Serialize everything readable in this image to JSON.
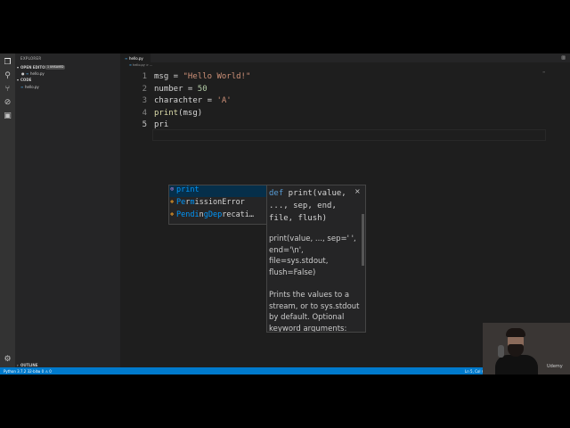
{
  "explorer": {
    "title": "EXPLORER",
    "open_editors": {
      "label": "OPEN EDITORS",
      "badge": "1 UNSAVED",
      "files": [
        {
          "name": "hello.py"
        }
      ]
    },
    "folder": {
      "label": "CODE",
      "files": [
        {
          "name": "hello.py"
        }
      ]
    },
    "outline_label": "OUTLINE"
  },
  "tab": {
    "name": "hello.py"
  },
  "breadcrumb": {
    "file": "hello.py",
    "rest": " > ..."
  },
  "editor": {
    "lines": [
      {
        "n": "1",
        "before": "msg = ",
        "str": "\"Hello World!\"",
        "after": ""
      },
      {
        "n": "2",
        "before": "number = ",
        "num": "50"
      },
      {
        "n": "3",
        "before": "charachter = ",
        "str": "'A'",
        "after": ""
      },
      {
        "n": "4",
        "fn": "print",
        "after": "(msg)"
      },
      {
        "n": "5",
        "before": "pri"
      }
    ]
  },
  "suggest": {
    "items": [
      {
        "icon": "method-icon",
        "match": "print",
        "rest": "",
        "selected": true
      },
      {
        "icon": "class-icon",
        "p1": "Pe",
        "m1": "r",
        "p2": "m",
        "m2": "i",
        "p3": "ssionError"
      },
      {
        "icon": "class-icon",
        "p1": "Pendi",
        "m1": "n",
        "p2": "gDep",
        "m2": "r",
        "p3": "ecati…"
      }
    ]
  },
  "detail": {
    "sig_kw": "def",
    "sig_rest": " print(value, ..., sep, end, file, flush)",
    "close": "×",
    "doc1": "print(value, ..., sep=' ', end='\\n', file=sys.stdout, flush=False)",
    "doc2": "Prints the values to a stream, or to sys.stdout by default. Optional keyword arguments:"
  },
  "status": {
    "interpreter": "Python 3.7.2 32-bit",
    "problems": "⊗ 0 ⚠ 0",
    "position": "Ln 5, Col 4"
  },
  "webcam_mark": "Udemy",
  "colors": {
    "accent": "#007acc",
    "editor_bg": "#1e1e1e",
    "sidebar_bg": "#252526",
    "activity_bg": "#333333"
  }
}
